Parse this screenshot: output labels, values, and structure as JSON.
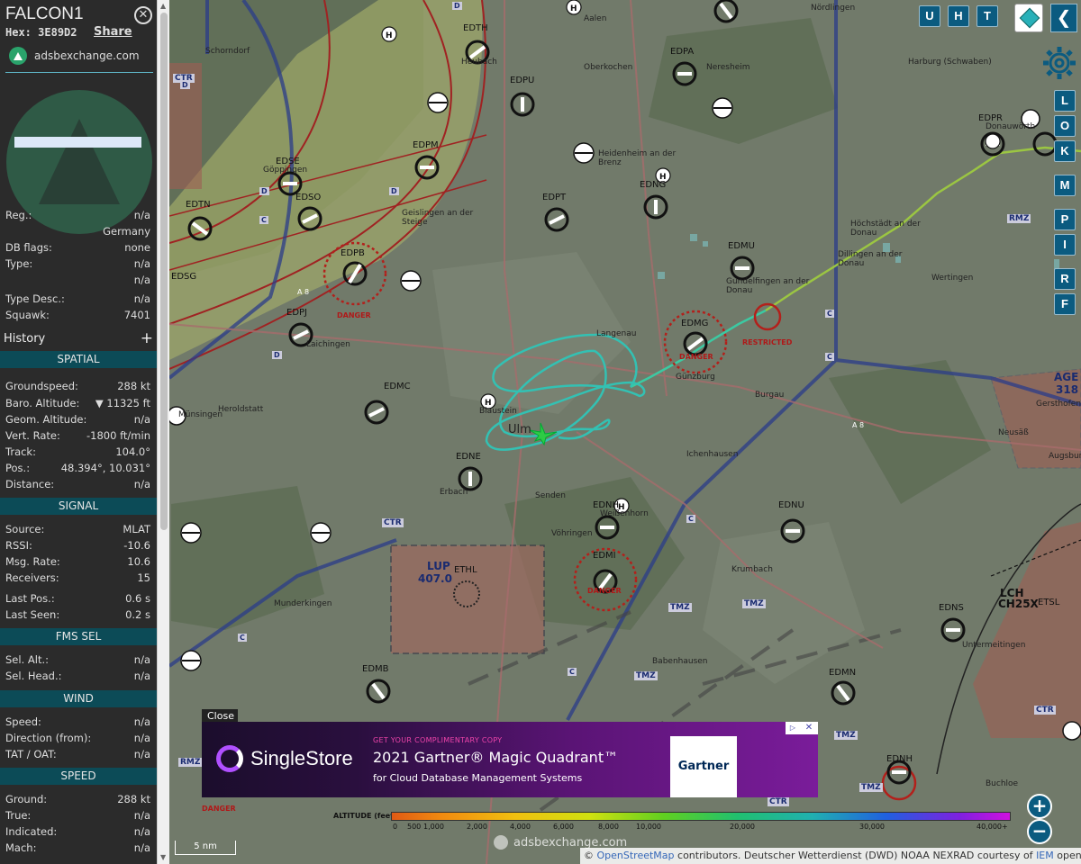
{
  "aircraft": {
    "callsign": "FALCON1",
    "hex_label": "Hex:",
    "hex": "3E89D2",
    "share": "Share",
    "brand": "adsbexchange.com"
  },
  "info": [
    {
      "label": "Reg.:",
      "value": "n/a"
    },
    {
      "label": "",
      "value": "Germany"
    },
    {
      "label": "DB flags:",
      "value": "none"
    },
    {
      "label": "Type:",
      "value": "n/a"
    },
    {
      "label": "",
      "value": "n/a"
    },
    {
      "label": "Type Desc.:",
      "value": "n/a"
    },
    {
      "label": "Squawk:",
      "value": "7401"
    }
  ],
  "history": {
    "label": "History",
    "plus": "+"
  },
  "sections": {
    "spatial": {
      "title": "SPATIAL",
      "rows": [
        {
          "label": "Groundspeed:",
          "value": "288 kt"
        },
        {
          "label": "Baro. Altitude:",
          "value": "▼ 11325 ft"
        },
        {
          "label": "Geom. Altitude:",
          "value": "n/a"
        },
        {
          "label": "Vert. Rate:",
          "value": "-1800 ft/min"
        },
        {
          "label": "Track:",
          "value": "104.0°"
        },
        {
          "label": "Pos.:",
          "value": "48.394°, 10.031°"
        },
        {
          "label": "Distance:",
          "value": "n/a"
        }
      ]
    },
    "signal": {
      "title": "SIGNAL",
      "rows": [
        {
          "label": "Source:",
          "value": "MLAT"
        },
        {
          "label": "RSSI:",
          "value": "-10.6"
        },
        {
          "label": "Msg. Rate:",
          "value": "10.6"
        },
        {
          "label": "Receivers:",
          "value": "15"
        },
        {
          "label": "Last Pos.:",
          "value": "0.6 s"
        },
        {
          "label": "Last Seen:",
          "value": "0.2 s"
        }
      ]
    },
    "fms": {
      "title": "FMS SEL",
      "rows": [
        {
          "label": "Sel. Alt.:",
          "value": "n/a"
        },
        {
          "label": "Sel. Head.:",
          "value": "n/a"
        }
      ]
    },
    "wind": {
      "title": "WIND",
      "rows": [
        {
          "label": "Speed:",
          "value": "n/a"
        },
        {
          "label": "Direction (from):",
          "value": "n/a"
        },
        {
          "label": "TAT / OAT:",
          "value": "n/a"
        }
      ]
    },
    "speed": {
      "title": "SPEED",
      "rows": [
        {
          "label": "Ground:",
          "value": "288 kt"
        },
        {
          "label": "True:",
          "value": "n/a"
        },
        {
          "label": "Indicated:",
          "value": "n/a"
        },
        {
          "label": "Mach:",
          "value": "n/a"
        }
      ]
    }
  },
  "map_buttons": {
    "u": "U",
    "h": "H",
    "t": "T",
    "side": [
      "L",
      "O",
      "K",
      "M",
      "P",
      "I",
      "R",
      "F"
    ],
    "chevron": "❮",
    "zoom_in": "+",
    "zoom_out": "−"
  },
  "map_labels": {
    "airfields": [
      "EDTH",
      "EDPA",
      "EDPU",
      "EDPM",
      "EDSE",
      "EDSO",
      "EDTN",
      "EDPT",
      "EDNG",
      "EDMU",
      "EDPR",
      "EDPB",
      "EDSG",
      "EDPJ",
      "EDMG",
      "EDMC",
      "EDNE",
      "EDNH",
      "EDNU",
      "EDMI",
      "EDMB",
      "EDMN",
      "EDNS",
      "EDNH"
    ],
    "towns": [
      "Aalen",
      "Schorndorf",
      "Göppingen",
      "Heubach",
      "Oberkochen",
      "Nördlingen",
      "Neresheim",
      "Harburg (Schwaben)",
      "Donauwörth",
      "Heidenheim an der Brenz",
      "Geislingen an der Steige",
      "Höchstädt an der Donau",
      "Dillingen an der Donau",
      "Gundelfingen an der Donau",
      "Wertingen",
      "Laichingen",
      "Langenau",
      "Günzburg",
      "Burgau",
      "Blaustein",
      "Ulm",
      "Heroldstatt",
      "Münsingen",
      "Erbach",
      "Senden",
      "Ichenhausen",
      "Weißenhorn",
      "Vöhringen",
      "Krumbach",
      "Munderkingen",
      "Babenhausen",
      "Untermeitingen",
      "Buchloe",
      "Gersthofen",
      "Neusäß",
      "Augsburg"
    ],
    "danger": "DANGER",
    "restricted": "RESTRICTED",
    "lup": "LUP",
    "lup_val": "407.0",
    "ethl": "ETHL",
    "lch": "LCH",
    "lch_val": "CH25X",
    "etsl": "ETSL",
    "age": "AGE",
    "age_val": "318",
    "ctr": "CTR",
    "tmz": "TMZ",
    "rmz": "RMZ",
    "c": "C",
    "d": "D",
    "a8": "A 8"
  },
  "ad": {
    "close": "Close",
    "brand": "SingleStore",
    "small": "GET YOUR COMPLIMENTARY COPY",
    "headline": "2021 Gartner® Magic Quadrant™",
    "sub": "for Cloud Database Management Systems",
    "gartner": "Gartner",
    "x": "✕",
    "tri": "▷"
  },
  "altitude_legend": {
    "title": "ALTITUDE (feet)",
    "ticks": [
      "0",
      "500",
      "1,000",
      "2,000",
      "4,000",
      "6,000",
      "8,000",
      "10,000",
      "20,000",
      "30,000",
      "40,000+"
    ]
  },
  "scale_label": "5 nm",
  "watermark": "adsbexchange.com",
  "attribution": {
    "prefix": "© ",
    "osm": "OpenStreetMap",
    "mid": " contributors. Deutscher Wetterdienst (DWD) NOAA NEXRAD courtesy of ",
    "iem": "IEM",
    "suffix": " openAIP.net"
  }
}
